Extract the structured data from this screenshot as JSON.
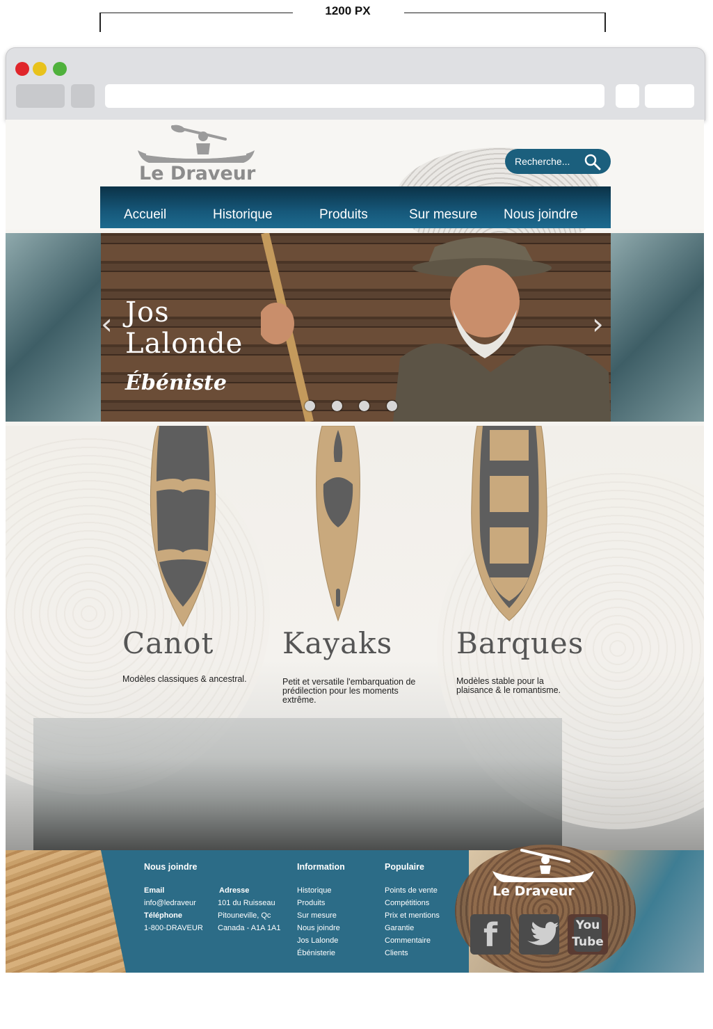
{
  "annotation": {
    "width_label": "1200 PX"
  },
  "header": {
    "brand": "Le Draveur",
    "search_placeholder": "Recherche...",
    "nav": [
      "Accueil",
      "Historique",
      "Produits",
      "Sur mesure",
      "Nous joindre"
    ]
  },
  "slider": {
    "title_line1": "Jos",
    "title_line2": "Lalonde",
    "subtitle": "Ébéniste",
    "prev": "‹",
    "next": "›"
  },
  "products": [
    {
      "title": "Canot",
      "desc": "Modèles classiques & ancestral."
    },
    {
      "title": "Kayaks",
      "desc": "Petit et versatile l'embarquation de prédilection pour les moments extrême."
    },
    {
      "title": "Barques",
      "desc": "Modèles stable pour la plaisance & le romantisme."
    }
  ],
  "footer": {
    "contact": {
      "heading": "Nous joindre",
      "email_label": "Email",
      "email": "info@ledraveur",
      "phone_label": "Téléphone",
      "phone": "1-800-DRAVEUR",
      "address_label": "Adresse",
      "address1": "101 du Ruisseau",
      "address2": "Pitouneville, Qc",
      "address3": "Canada - A1A 1A1"
    },
    "information": {
      "heading": "Information",
      "links": [
        "Historique",
        "Produits",
        "Sur mesure",
        "Nous joindre",
        "Jos Lalonde",
        "Ébénisterie"
      ]
    },
    "popular": {
      "heading": "Populaire",
      "links": [
        "Points de vente",
        "Compétitions",
        "Prix et mentions",
        "Garantie",
        "Commentaire",
        "Clients"
      ]
    },
    "brand": "Le Draveur",
    "social": {
      "youtube_top": "You",
      "youtube_bottom": "Tube"
    }
  },
  "colors": {
    "nav_blue": "#16587a",
    "footer_blue": "#2c6c87",
    "boat_tan": "#c9a97d",
    "boat_gray": "#5e5e5e"
  }
}
